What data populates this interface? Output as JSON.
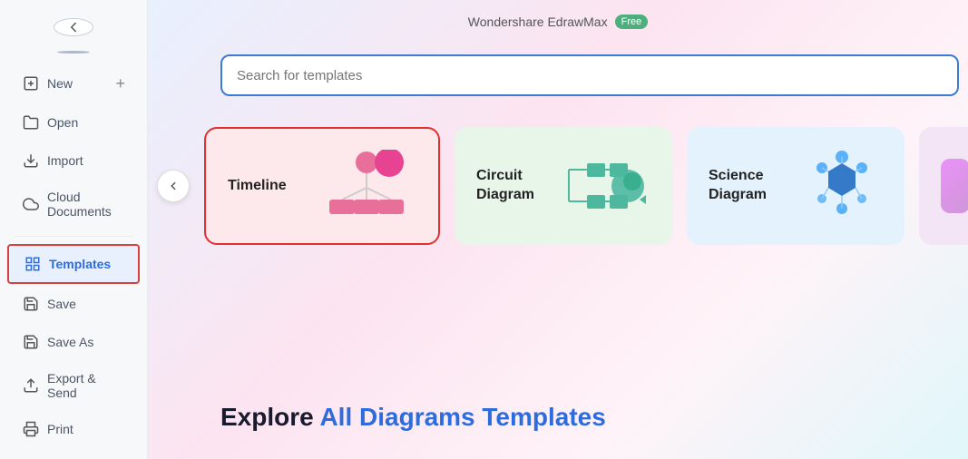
{
  "app": {
    "title": "Wondershare EdrawMax",
    "badge": "Free"
  },
  "sidebar": {
    "back_icon": "←",
    "items": [
      {
        "id": "new",
        "label": "New",
        "icon": "new"
      },
      {
        "id": "open",
        "label": "Open",
        "icon": "open"
      },
      {
        "id": "import",
        "label": "Import",
        "icon": "import"
      },
      {
        "id": "cloud",
        "label": "Cloud Documents",
        "icon": "cloud"
      },
      {
        "id": "templates",
        "label": "Templates",
        "icon": "templates",
        "active": true
      },
      {
        "id": "save",
        "label": "Save",
        "icon": "save"
      },
      {
        "id": "saveas",
        "label": "Save As",
        "icon": "saveas"
      },
      {
        "id": "export",
        "label": "Export & Send",
        "icon": "export"
      },
      {
        "id": "print",
        "label": "Print",
        "icon": "print"
      }
    ]
  },
  "search": {
    "placeholder": "Search for templates"
  },
  "cards": [
    {
      "id": "timeline",
      "label": "Timeline",
      "type": "timeline"
    },
    {
      "id": "circuit",
      "label": "Circuit\nDiagram",
      "type": "circuit"
    },
    {
      "id": "science",
      "label": "Science\nDiagram",
      "type": "science"
    }
  ],
  "explore": {
    "prefix": "Explore ",
    "highlight": "All Diagrams Templates"
  }
}
